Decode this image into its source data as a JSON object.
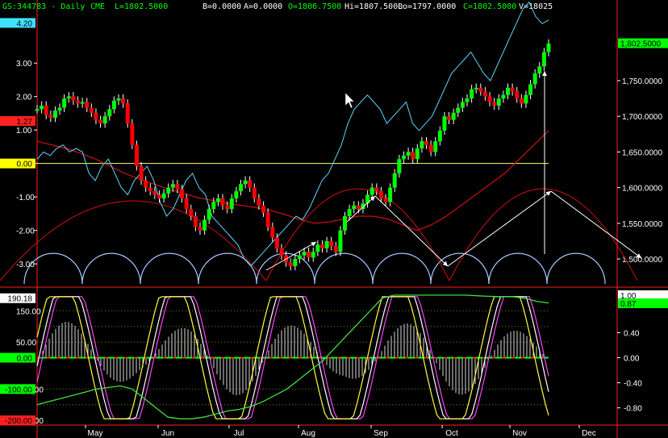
{
  "header": {
    "symbol": "GS:344783 - Daily",
    "exchange": "CME",
    "last": "L=1802.5000",
    "bid": "B=0.0000",
    "ask": "A=0.0000",
    "open": "O=1806.7500",
    "high": "Hi=1807.5000",
    "low": "Lo=1797.0000",
    "close": "C=1802.5000",
    "volume": "V=18025"
  },
  "colors": {
    "background": "#000000",
    "up_bar": "#00ff00",
    "down_bar": "#ff0000",
    "cyan_line": "#5fd7ff",
    "red_curve": "#d01010",
    "cycle_arcs": "#a8c8ff",
    "zero_line": "#ffff66",
    "magenta": "#ff40ff",
    "yellow": "#ffff40",
    "green_line": "#40e040",
    "histogram": "#d8d8d8",
    "arrows": "#ffffff"
  },
  "chart_data": [
    {
      "type": "candlestick",
      "name": "price",
      "x_labels": [
        "May",
        "Jun",
        "Jul",
        "Aug",
        "Sep",
        "Oct",
        "Nov",
        "Dec"
      ],
      "y_right_ticks": [
        "1,500.0000",
        "1,550.0000",
        "1,600.0000",
        "1,650.0000",
        "1,700.0000",
        "1,750.0000"
      ],
      "y_right_range": [
        1465,
        1845
      ],
      "y_left_ticks": [
        "3.00",
        "2.00",
        "1.00",
        "0.00",
        "-1.00",
        "-2.00",
        "-3.00"
      ],
      "y_left_range": [
        -3.6,
        4.5
      ],
      "badges": [
        {
          "text": "4.20",
          "side": "left",
          "value": 4.2,
          "color": "#40e0ff"
        },
        {
          "text": "1.27",
          "side": "left",
          "value": 1.27,
          "color": "#ff2020"
        },
        {
          "text": "0.00",
          "side": "left",
          "value": 0.0,
          "color": "#ffff00"
        },
        {
          "text": "1,802.5000",
          "side": "right",
          "value": 1802.5,
          "color": "#00ff00"
        }
      ],
      "close_series": [
        1710,
        1715,
        1702,
        1698,
        1708,
        1712,
        1725,
        1728,
        1722,
        1718,
        1720,
        1712,
        1705,
        1695,
        1690,
        1700,
        1710,
        1722,
        1725,
        1718,
        1690,
        1660,
        1630,
        1610,
        1600,
        1595,
        1590,
        1585,
        1592,
        1600,
        1605,
        1598,
        1585,
        1570,
        1560,
        1545,
        1540,
        1555,
        1570,
        1580,
        1585,
        1575,
        1570,
        1585,
        1595,
        1605,
        1610,
        1600,
        1585,
        1575,
        1565,
        1545,
        1530,
        1515,
        1505,
        1495,
        1490,
        1500,
        1505,
        1510,
        1502,
        1510,
        1520,
        1515,
        1525,
        1518,
        1510,
        1540,
        1560,
        1570,
        1575,
        1570,
        1578,
        1590,
        1600,
        1595,
        1585,
        1580,
        1600,
        1620,
        1640,
        1645,
        1650,
        1640,
        1655,
        1665,
        1660,
        1650,
        1665,
        1680,
        1700,
        1695,
        1705,
        1712,
        1720,
        1725,
        1738,
        1740,
        1735,
        1728,
        1720,
        1715,
        1725,
        1730,
        1740,
        1735,
        1725,
        1718,
        1730,
        1745,
        1760,
        1770,
        1790,
        1802
      ],
      "cyan_series": [
        1640,
        1650,
        1645,
        1655,
        1660,
        1650,
        1655,
        1650,
        1620,
        1610,
        1630,
        1640,
        1620,
        1600,
        1590,
        1610,
        1620,
        1630,
        1610,
        1580,
        1560,
        1570,
        1590,
        1610,
        1620,
        1600,
        1590,
        1560,
        1550,
        1540,
        1530,
        1520,
        1500,
        1490,
        1500,
        1510,
        1520,
        1530,
        1540,
        1550,
        1560,
        1555,
        1570,
        1590,
        1610,
        1620,
        1640,
        1660,
        1690,
        1710,
        1720,
        1730,
        1720,
        1710,
        1690,
        1700,
        1710,
        1720,
        1690,
        1680,
        1690,
        1700,
        1720,
        1740,
        1760,
        1770,
        1780,
        1790,
        1775,
        1760,
        1750,
        1770,
        1790,
        1810,
        1830,
        1850,
        1860,
        1840,
        1830,
        1835
      ],
      "red_curve": [
        1665,
        1660,
        1655,
        1648,
        1640,
        1630,
        1620,
        1612,
        1605,
        1598,
        1592,
        1586,
        1582,
        1578,
        1575,
        1572,
        1568,
        1562,
        1555,
        1550,
        1552,
        1556,
        1560,
        1560,
        1556,
        1548,
        1540,
        1548,
        1560,
        1575,
        1590,
        1605,
        1620,
        1640,
        1660,
        1680
      ],
      "arrows": [
        {
          "from": [
            430,
            275
          ],
          "to": [
            465,
            243
          ]
        },
        {
          "from": [
            465,
            243
          ],
          "to": [
            555,
            330
          ]
        },
        {
          "from": [
            555,
            330
          ],
          "to": [
            683,
            237
          ]
        },
        {
          "from": [
            683,
            237
          ],
          "to": [
            795,
            320
          ]
        },
        {
          "from": [
            675,
            315
          ],
          "to": [
            675,
            88
          ]
        },
        {
          "from": [
            330,
            335
          ],
          "to": [
            392,
            300
          ]
        }
      ]
    },
    {
      "type": "oscillator",
      "name": "lower",
      "y_left_ticks": [
        "150.00",
        "50.00",
        "0.00",
        "-100.00",
        "-200.00"
      ],
      "y_left_range": [
        -210,
        210
      ],
      "y_right_ticks": [
        "0.40",
        "0.00",
        "-0.40",
        "-0.80"
      ],
      "y_right_range": [
        -1.05,
        1.05
      ],
      "badges": [
        {
          "text": "190.18",
          "side": "left",
          "value": 190.18,
          "color": "#ffffff"
        },
        {
          "text": "0.00",
          "side": "left",
          "value": 0.0,
          "color": "#00ff00"
        },
        {
          "text": "-100.00",
          "side": "left",
          "value": -100.0,
          "color": "#00ff00"
        },
        {
          "text": "-200.00",
          "side": "left",
          "value": -200.0,
          "color": "#ff2020"
        },
        {
          "text": "1.00",
          "side": "right",
          "value": 1.0,
          "color": "#ffffff"
        },
        {
          "text": "0.87",
          "side": "right",
          "value": 0.87,
          "color": "#00ff00"
        }
      ],
      "green_series": [
        -150,
        -140,
        -130,
        -120,
        -110,
        -100,
        -95,
        -90,
        -100,
        -130,
        -160,
        -190,
        -195,
        -195,
        -190,
        -180,
        -170,
        -165,
        -155,
        -140,
        -120,
        -100,
        -70,
        -40,
        -10,
        30,
        70,
        110,
        150,
        190,
        200,
        200,
        200,
        200,
        200,
        200,
        200,
        198,
        196,
        195,
        195,
        190,
        180,
        175
      ]
    }
  ]
}
